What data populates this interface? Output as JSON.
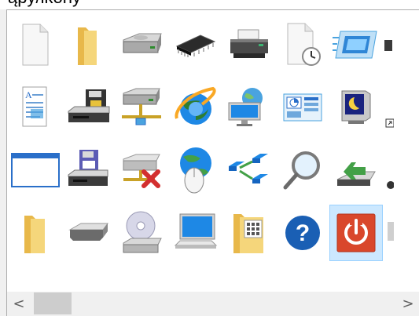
{
  "caption": {
    "text": "ąpy/ikony"
  },
  "icons": [
    {
      "name": "blank-document-icon"
    },
    {
      "name": "folder-icon"
    },
    {
      "name": "hard-drive-icon"
    },
    {
      "name": "memory-chip-icon"
    },
    {
      "name": "printer-icon"
    },
    {
      "name": "scheduled-document-icon"
    },
    {
      "name": "monitor-display-icon"
    },
    {
      "name": "partial-icon"
    },
    {
      "name": "text-document-icon"
    },
    {
      "name": "floppy-drive-icon"
    },
    {
      "name": "network-drive-icon"
    },
    {
      "name": "internet-explorer-icon"
    },
    {
      "name": "network-globe-icon"
    },
    {
      "name": "control-panel-icon"
    },
    {
      "name": "screen-saver-icon"
    },
    {
      "name": "shortcut-partial-icon"
    },
    {
      "name": "application-window-icon"
    },
    {
      "name": "backup-floppy-drive-icon"
    },
    {
      "name": "disconnected-drive-icon"
    },
    {
      "name": "globe-mouse-icon"
    },
    {
      "name": "network-connections-icon"
    },
    {
      "name": "search-magnifier-icon"
    },
    {
      "name": "usb-install-icon"
    },
    {
      "name": "partial-icon"
    },
    {
      "name": "yellow-folder-icon"
    },
    {
      "name": "removable-drive-icon"
    },
    {
      "name": "cd-drive-icon"
    },
    {
      "name": "computer-screen-icon"
    },
    {
      "name": "keypad-folder-icon"
    },
    {
      "name": "help-icon"
    },
    {
      "name": "power-button-icon"
    },
    {
      "name": "partial-icon"
    }
  ],
  "selected_icon": "power-button-icon",
  "help_glyph": "?",
  "scrollbar": {
    "left_arrow": "<",
    "right_arrow": ">"
  },
  "colors": {
    "selection": "#cce8ff",
    "selection_border": "#99d1ff",
    "help_blue": "#1a5fb4",
    "power_red": "#d9472b"
  }
}
